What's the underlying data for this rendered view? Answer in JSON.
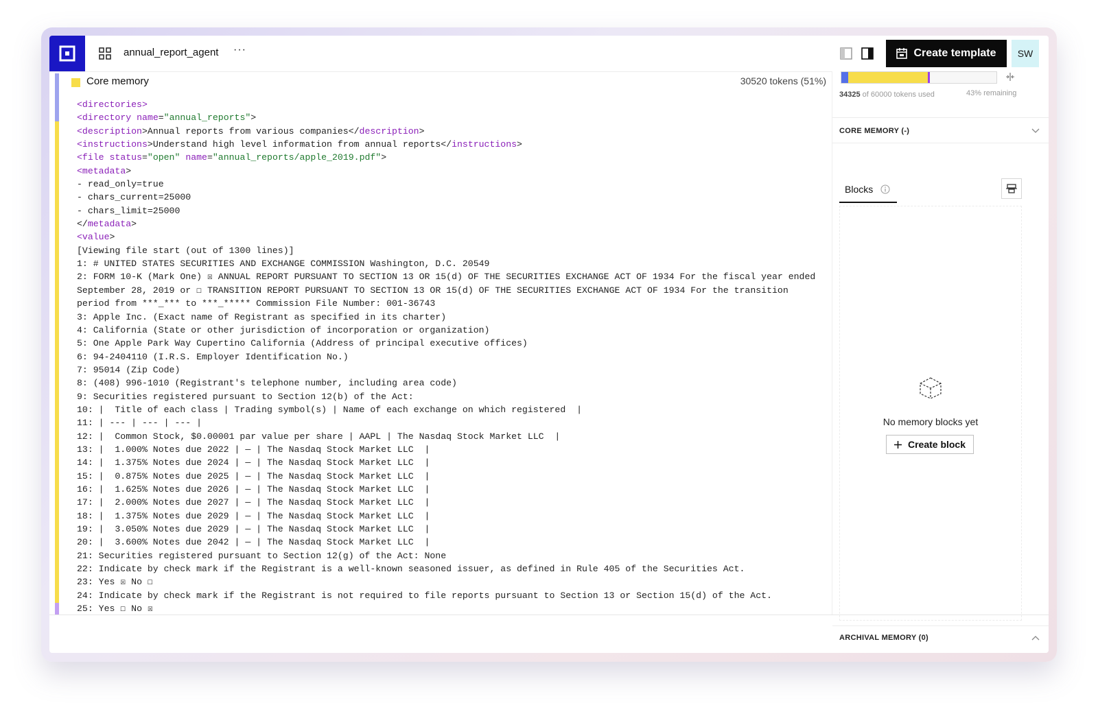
{
  "header": {
    "agent_name": "annual_report_agent",
    "more_label": "···",
    "create_template_label": "Create template",
    "avatar_initials": "SW"
  },
  "core_memory": {
    "title": "Core memory",
    "tokens_label": "30520 tokens (51%)",
    "swatch_color": "#f7dd4a"
  },
  "content": {
    "directories_open": "directories",
    "directory_tag": "directory",
    "directory_name_attr": "name",
    "directory_name_value": "\"annual_reports\"",
    "description_tag": "description",
    "description_text": "Annual reports from various companies",
    "instructions_tag": "instructions",
    "instructions_text": "Understand high level information from annual reports",
    "file_tag": "file",
    "file_status_attr": "status",
    "file_status_value": "\"open\"",
    "file_name_attr": "name",
    "file_name_value": "\"annual_reports/apple_2019.pdf\"",
    "metadata_tag": "metadata",
    "metadata_lines": [
      "- read_only=true",
      "- chars_current=25000",
      "- chars_limit=25000"
    ],
    "value_tag": "value",
    "lines": [
      "[Viewing file start (out of 1300 lines)]",
      "1: # UNITED STATES SECURITIES AND EXCHANGE COMMISSION Washington, D.C. 20549",
      "2: FORM 10-K (Mark One) ☒ ANNUAL REPORT PURSUANT TO SECTION 13 OR 15(d) OF THE SECURITIES EXCHANGE ACT OF 1934 For the fiscal year ended September 28, 2019 or ☐ TRANSITION REPORT PURSUANT TO SECTION 13 OR 15(d) OF THE SECURITIES EXCHANGE ACT OF 1934 For the transition period from ***_*** to ***_***** Commission File Number: 001-36743",
      "3: Apple Inc. (Exact name of Registrant as specified in its charter)",
      "4: California (State or other jurisdiction of incorporation or organization)",
      "5: One Apple Park Way Cupertino California (Address of principal executive offices)",
      "6: 94-2404110 (I.R.S. Employer Identification No.)",
      "7: 95014 (Zip Code)",
      "8: (408) 996-1010 (Registrant's telephone number, including area code)",
      "9: Securities registered pursuant to Section 12(b) of the Act:",
      "10: |  Title of each class | Trading symbol(s) | Name of each exchange on which registered  |",
      "11: | --- | --- | --- |",
      "12: |  Common Stock, $0.00001 par value per share | AAPL | The Nasdaq Stock Market LLC  |",
      "13: |  1.000% Notes due 2022 | — | The Nasdaq Stock Market LLC  |",
      "14: |  1.375% Notes due 2024 | — | The Nasdaq Stock Market LLC  |",
      "15: |  0.875% Notes due 2025 | — | The Nasdaq Stock Market LLC  |",
      "16: |  1.625% Notes due 2026 | — | The Nasdaq Stock Market LLC  |",
      "17: |  2.000% Notes due 2027 | — | The Nasdaq Stock Market LLC  |",
      "18: |  1.375% Notes due 2029 | — | The Nasdaq Stock Market LLC  |",
      "19: |  3.050% Notes due 2029 | — | The Nasdaq Stock Market LLC  |",
      "20: |  3.600% Notes due 2042 | — | The Nasdaq Stock Market LLC  |",
      "21: Securities registered pursuant to Section 12(g) of the Act: None",
      "22: Indicate by check mark if the Registrant is a well-known seasoned issuer, as defined in Rule 405 of the Securities Act.",
      "23: Yes ☒ No ☐",
      "24: Indicate by check mark if the Registrant is not required to file reports pursuant to Section 13 or Section 15(d) of the Act.",
      "25: Yes ☐ No ☒"
    ]
  },
  "sidebar": {
    "context": {
      "used_value": "34325",
      "used_suffix": "of 60000 tokens used",
      "remaining_label": "43% remaining",
      "used_fraction": 0.57,
      "segment_colors": [
        "#5570e8",
        "#f7dd4a",
        "#9b3fe8"
      ]
    },
    "core_memory_label": "CORE MEMORY (-)",
    "blocks_tab_label": "Blocks",
    "empty_message": "No memory blocks yet",
    "create_block_label": "Create block",
    "archival_memory_label": "ARCHIVAL MEMORY (0)"
  },
  "icons": {
    "logo": "letta-logo-icon",
    "grid": "grid-icon",
    "panel_left": "panel-left-icon",
    "panel_right": "panel-right-icon",
    "template": "template-icon",
    "collapse": "collapse-icon",
    "chevron_down": "chevron-down-icon",
    "chevron_up": "chevron-up-icon",
    "info": "info-icon",
    "block_tool": "block-tool-icon",
    "cube": "cube-icon",
    "plus": "plus-icon"
  }
}
